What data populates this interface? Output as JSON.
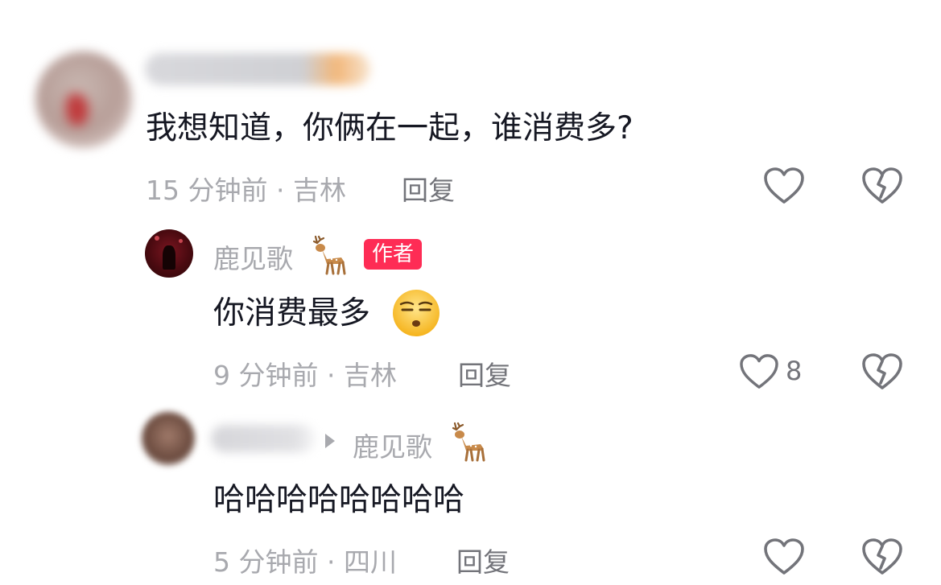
{
  "comments": [
    {
      "text": "我想知道，你俩在一起，谁消费多?",
      "time": "15 分钟前 · 吉林",
      "reply_label": "回复"
    },
    {
      "username": "鹿见歌",
      "username_emoji": "deer-emoji",
      "badge": "作者",
      "text": "你消费最多",
      "text_emoji": "unamused-face-emoji",
      "time": "9 分钟前 · 吉林",
      "reply_label": "回复",
      "like_count": "8"
    },
    {
      "reply_to": "鹿见歌",
      "reply_to_emoji": "deer-emoji",
      "text": "哈哈哈哈哈哈哈哈",
      "time": "5 分钟前 · 四川",
      "reply_label": "回复"
    }
  ],
  "colors": {
    "text": "#161823",
    "meta": "#a8a9ae",
    "reply": "#73747a",
    "badge": "#fe2c55",
    "icon_stroke": "#73747a"
  }
}
